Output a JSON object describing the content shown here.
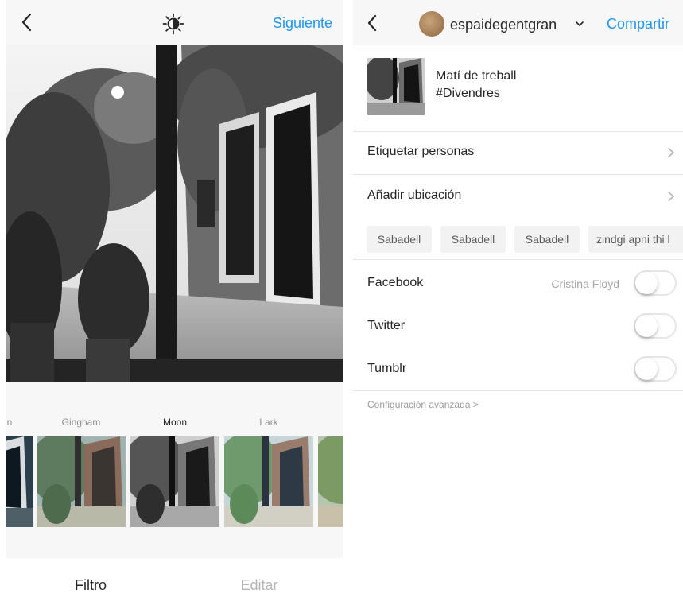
{
  "left_screen": {
    "next_label": "Siguiente",
    "filters": [
      {
        "name": "n"
      },
      {
        "name": "Gingham"
      },
      {
        "name": "Moon"
      },
      {
        "name": "Lark"
      }
    ],
    "tabs": {
      "filter": "Filtro",
      "edit": "Editar"
    },
    "icons": {
      "back": "back-arrow-icon",
      "adjust": "lux-sun-icon"
    }
  },
  "right_screen": {
    "username": "espaidegentgran",
    "share_label": "Compartir",
    "caption_line1": "Matí de treball",
    "caption_line2": "#Divendres",
    "tag_people": "Etiquetar personas",
    "add_location": "Añadir ubicación",
    "location_chips": [
      "Sabadell",
      "Sabadell",
      "Sabadell",
      "zindgi apni thi l"
    ],
    "share_to": [
      {
        "network": "Facebook",
        "account": "Cristina Floyd",
        "enabled": false
      },
      {
        "network": "Twitter",
        "account": "",
        "enabled": false
      },
      {
        "network": "Tumblr",
        "account": "",
        "enabled": false
      }
    ],
    "advanced": "Configuración avanzada >"
  },
  "colors": {
    "accent": "#2196f3",
    "text": "#262626",
    "muted": "#8e8e8e",
    "divider": "#e5e5e5"
  }
}
